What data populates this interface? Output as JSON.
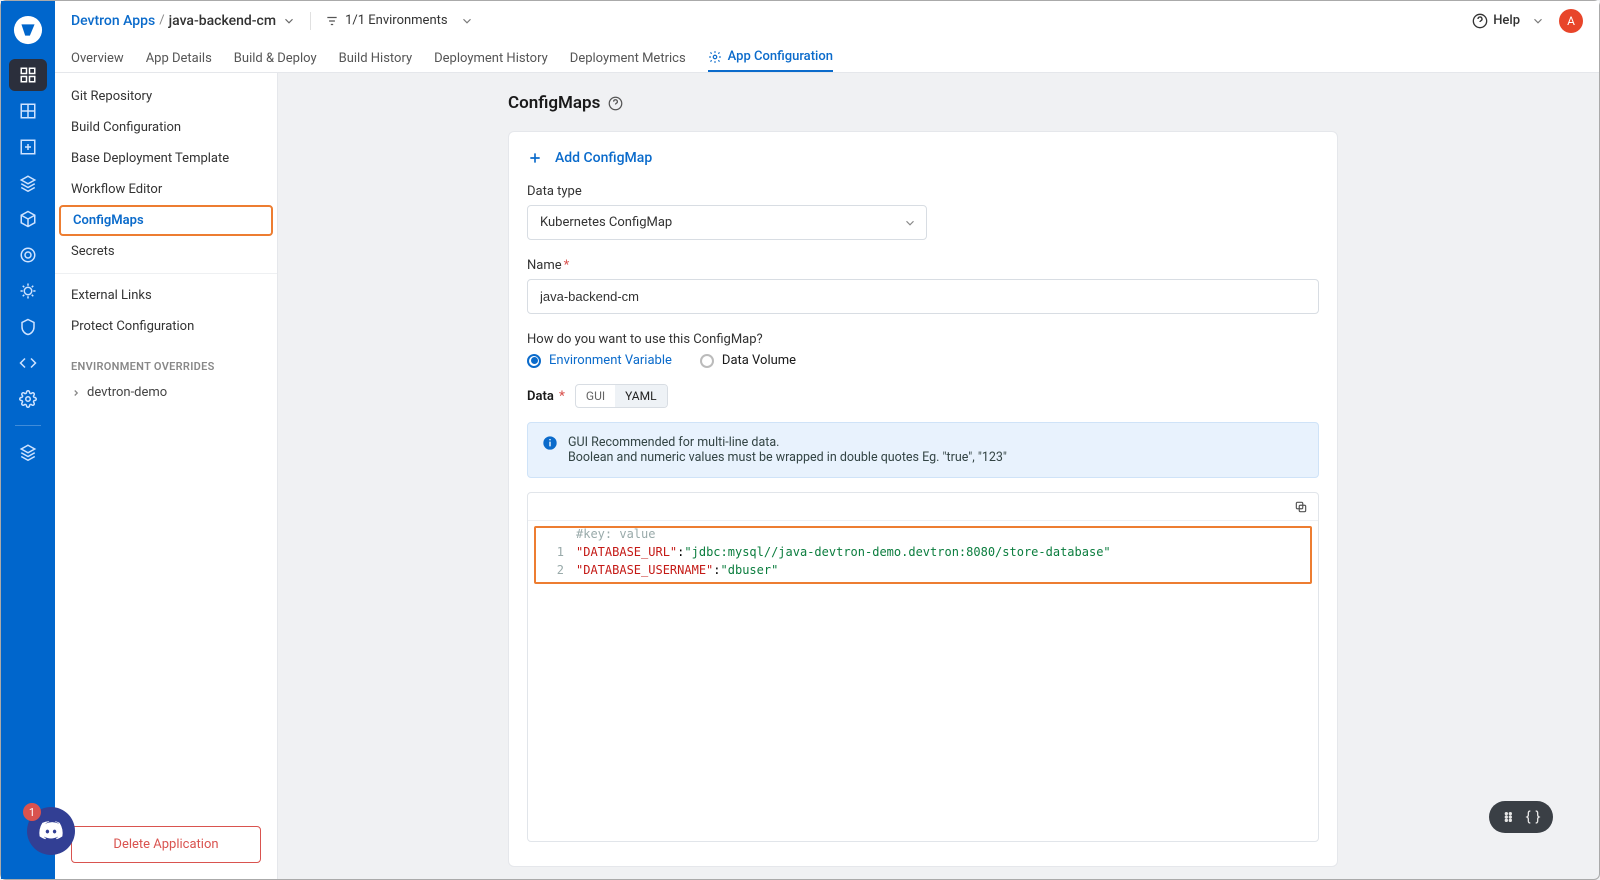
{
  "breadcrumb": {
    "root": "Devtron Apps",
    "app": "java-backend-cm"
  },
  "env_filter": "1/1 Environments",
  "help_label": "Help",
  "avatar_letter": "A",
  "tabs": [
    "Overview",
    "App Details",
    "Build & Deploy",
    "Build History",
    "Deployment History",
    "Deployment Metrics",
    "App Configuration"
  ],
  "active_tab": "App Configuration",
  "subnav": {
    "items": [
      "Git Repository",
      "Build Configuration",
      "Base Deployment Template",
      "Workflow Editor",
      "ConfigMaps",
      "Secrets"
    ],
    "highlighted": "ConfigMaps",
    "group2": [
      "External Links",
      "Protect Configuration"
    ],
    "env_heading": "ENVIRONMENT OVERRIDES",
    "envs": [
      "devtron-demo"
    ],
    "delete_label": "Delete Application"
  },
  "page": {
    "title": "ConfigMaps",
    "add_label": "Add ConfigMap",
    "field_datatype_label": "Data type",
    "datatype_value": "Kubernetes ConfigMap",
    "field_name_label": "Name",
    "name_value": "java-backend-cm",
    "howuse_label": "How do you want to use this ConfigMap?",
    "radio_env": "Environment Variable",
    "radio_vol": "Data Volume",
    "data_label": "Data",
    "seg_gui": "GUI",
    "seg_yaml": "YAML",
    "info_line1": "GUI Recommended for multi-line data.",
    "info_line2": "Boolean and numeric values must be wrapped in double quotes Eg. \"true\", \"123\"",
    "code_hint": "#key: value",
    "code": [
      {
        "n": "1",
        "key": "\"DATABASE_URL\"",
        "val": "\"jdbc:mysql//java-devtron-demo.devtron:8080/store-database\""
      },
      {
        "n": "2",
        "key": "\"DATABASE_USERNAME\"",
        "val": "\"dbuser\""
      }
    ]
  },
  "discord_badge": "1"
}
